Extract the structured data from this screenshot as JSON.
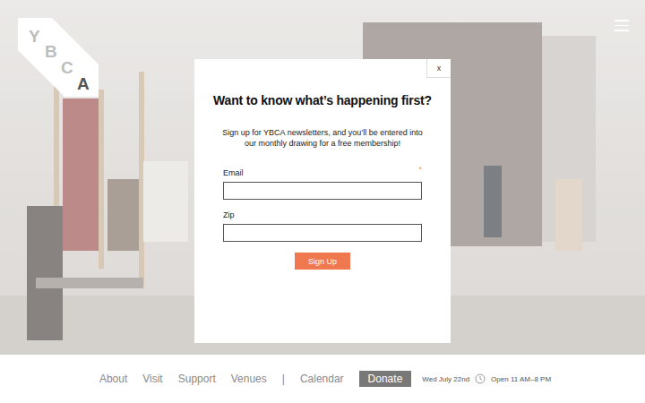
{
  "logo": {
    "letters": [
      "Y",
      "B",
      "C",
      "A"
    ]
  },
  "modal": {
    "close": "x",
    "title": "Want to know what’s happening first?",
    "body": "Sign up for YBCA newsletters, and you’ll be entered into our monthly drawing for a free membership!",
    "required_mark": "*",
    "fields": [
      {
        "label": "Email",
        "required": true,
        "value": ""
      },
      {
        "label": "Zip",
        "required": false,
        "value": ""
      }
    ],
    "button": "Sign Up"
  },
  "nav": {
    "items": [
      {
        "label": "About"
      },
      {
        "label": "Visit"
      },
      {
        "label": "Support"
      },
      {
        "label": "Venues"
      }
    ],
    "separator": "|",
    "secondary": [
      {
        "label": "Calendar",
        "kind": "link"
      },
      {
        "label": "Donate",
        "kind": "button"
      }
    ],
    "date": "Wed July 22nd",
    "hours": "Open 11 AM–8 PM"
  }
}
